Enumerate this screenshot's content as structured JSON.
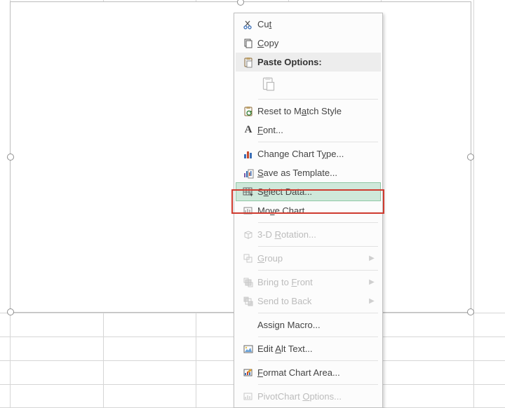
{
  "menu": {
    "cut": "Cut",
    "copy": "Copy",
    "paste_options": "Paste Options:",
    "reset_match_style": "Reset to Match Style",
    "font": "Font...",
    "change_chart_type": "Change Chart Type...",
    "save_as_template": "Save as Template...",
    "select_data": "Select Data...",
    "move_chart": "Move Chart...",
    "rotation_3d": "3-D Rotation...",
    "group": "Group",
    "bring_to_front": "Bring to Front",
    "send_to_back": "Send to Back",
    "assign_macro": "Assign Macro...",
    "edit_alt_text": "Edit Alt Text...",
    "format_chart_area": "Format Chart Area...",
    "pivotchart_options": "PivotChart Options..."
  }
}
